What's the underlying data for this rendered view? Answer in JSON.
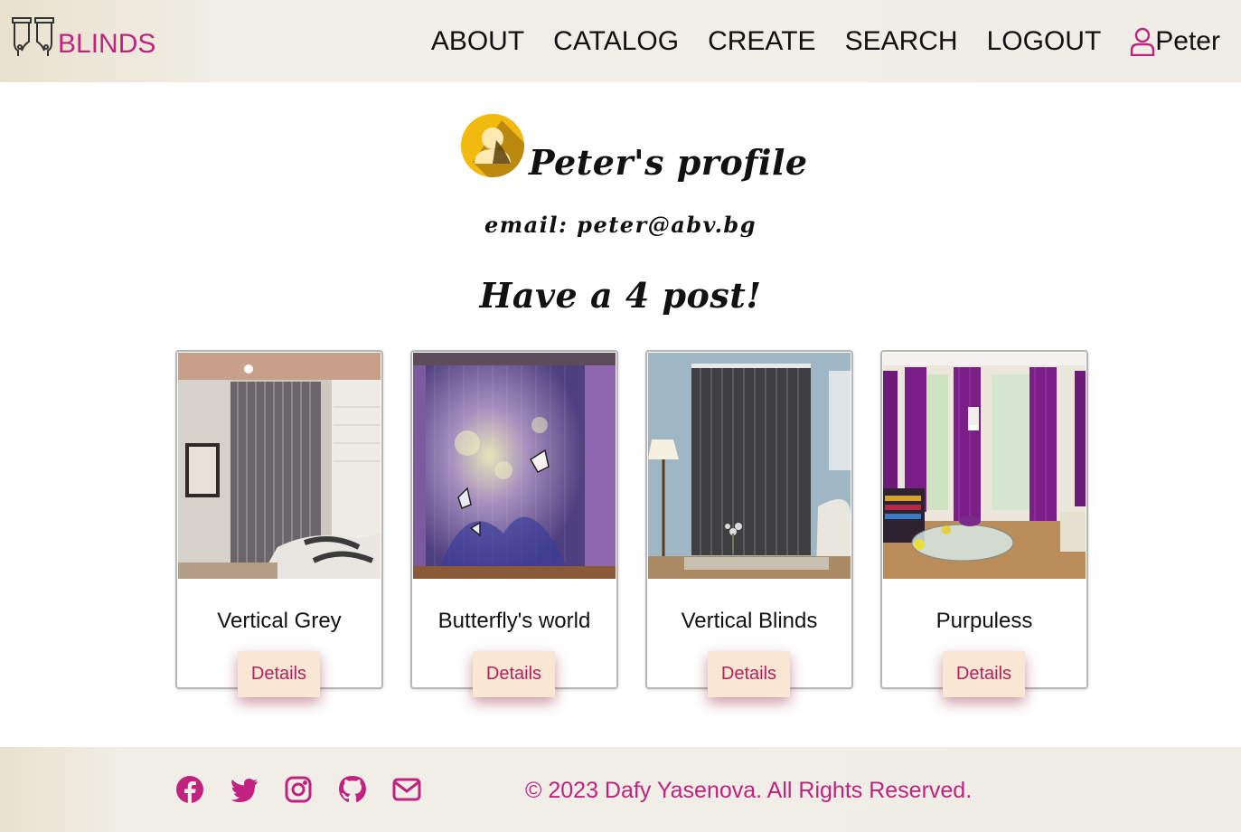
{
  "header": {
    "logo_text": "BLINDS",
    "logo_icon": "curtains-icon",
    "nav": [
      "ABOUT",
      "CATALOG",
      "CREATE",
      "SEARCH",
      "LOGOUT"
    ],
    "user_icon": "user-outline-icon",
    "user_name": "Peter"
  },
  "profile": {
    "avatar_icon": "user-avatar-icon",
    "title": "Peter's profile",
    "email_line": "email: peter@abv.bg",
    "posts_line": "Have a 4 post!"
  },
  "posts": [
    {
      "title": "Vertical Grey",
      "button": "Details"
    },
    {
      "title": "Butterfly's world",
      "button": "Details"
    },
    {
      "title": "Vertical Blinds",
      "button": "Details"
    },
    {
      "title": "Purpuless",
      "button": "Details"
    }
  ],
  "footer": {
    "social_icons": [
      "facebook-icon",
      "twitter-icon",
      "instagram-icon",
      "github-icon",
      "mail-icon"
    ],
    "copyright": "© 2023 Dafy Yasenova. All Rights Reserved."
  },
  "colors": {
    "brand": "#c2227f",
    "button_bg": "#f9e7d4",
    "header_bg": "#efede6",
    "avatar_yellow": "#f2b90f"
  }
}
